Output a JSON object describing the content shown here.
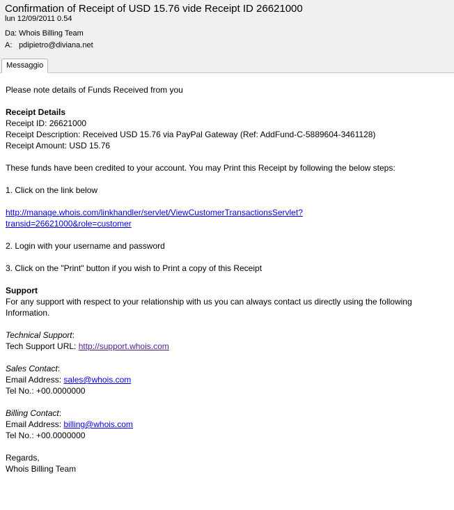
{
  "email": {
    "subject": "Confirmation of Receipt of USD 15.76 vide Receipt ID 26621000",
    "date": "lun 12/09/2011 0.54",
    "from_label": "Da:",
    "from_value": "Whois Billing Team",
    "to_label": "A:",
    "to_value": "pdipietro@diviana.net"
  },
  "tabs": [
    {
      "label": "Messaggio",
      "active": true
    }
  ],
  "body": {
    "intro": "Please note details of Funds Received from you",
    "receipt_heading": "Receipt Details",
    "receipt_id": "Receipt ID: 26621000",
    "receipt_description": "Receipt Description: Received USD 15.76 via PayPal Gateway (Ref: AddFund-C-5889604-3461128)",
    "receipt_amount": "Receipt Amount: USD 15.76",
    "credited_text": "These funds have been credited to your account. You may Print this Receipt by following the below steps:",
    "step1": "1. Click on the link below",
    "transaction_link_line1": "http://manage.whois.com/linkhandler/servlet/ViewCustomerTransactionsServlet?",
    "transaction_link_line2": "transid=26621000&role=customer",
    "step2": "2. Login with your username and password",
    "step3": "3. Click on the \"Print\" button if you wish to Print a copy of this Receipt",
    "support_heading": "Support",
    "support_text_line1": "For any support with respect to your relationship with us you can always contact us directly using the following",
    "support_text_line2": "Information.",
    "tech_support_heading": "Technical Support",
    "tech_support_label": "Tech Support URL: ",
    "tech_support_url": "http://support.whois.com",
    "sales_heading": "Sales Contact",
    "sales_email_label": "Email Address: ",
    "sales_email": "sales@whois.com",
    "sales_tel": "Tel No.: +00.0000000",
    "billing_heading": "Billing Contact",
    "billing_email_label": "Email Address: ",
    "billing_email": "billing@whois.com",
    "billing_tel": "Tel No.: +00.0000000",
    "regards": "Regards,",
    "signature": "Whois Billing Team",
    "colon": ":"
  },
  "colors": {
    "header_bg": "#f0f0f0",
    "link": "#0000ee",
    "visited_link": "#551a8b"
  }
}
